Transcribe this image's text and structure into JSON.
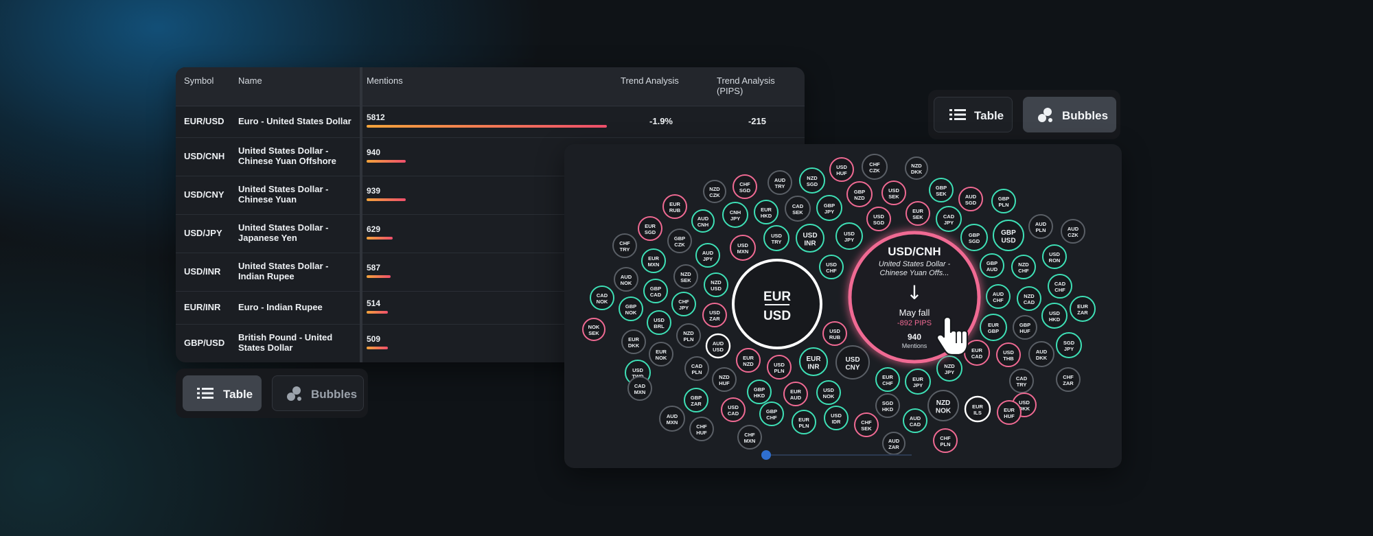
{
  "colors": {
    "positive": "#3ee0b6",
    "negative": "#f06a93",
    "neutral": "#5a5f66",
    "highlight": "#ffffff",
    "accent_text": "#f06a93",
    "bar_start": "#f3a43b",
    "bar_end": "#ef4f6c"
  },
  "table": {
    "headers": {
      "symbol": "Symbol",
      "name": "Name",
      "mentions": "Mentions",
      "trend": "Trend Analysis",
      "pips_line1": "Trend Analysis",
      "pips_line2": "(PIPS)"
    },
    "rows": [
      {
        "symbol": "EUR/USD",
        "name": "Euro - United States Dollar",
        "mentions": "5812",
        "trend": "-1.9%",
        "pips": "-215"
      },
      {
        "symbol": "USD/CNH",
        "name": "United States Dollar - Chinese Yuan Offshore",
        "mentions": "940",
        "trend": "",
        "pips": ""
      },
      {
        "symbol": "USD/CNY",
        "name": "United States Dollar - Chinese Yuan",
        "mentions": "939",
        "trend": "",
        "pips": ""
      },
      {
        "symbol": "USD/JPY",
        "name": "United States Dollar - Japanese Yen",
        "mentions": "629",
        "trend": "",
        "pips": ""
      },
      {
        "symbol": "USD/INR",
        "name": "United States Dollar - Indian Rupee",
        "mentions": "587",
        "trend": "",
        "pips": ""
      },
      {
        "symbol": "EUR/INR",
        "name": "Euro - Indian Rupee",
        "mentions": "514",
        "trend": "",
        "pips": ""
      },
      {
        "symbol": "GBP/USD",
        "name": "British Pound - United States Dollar",
        "mentions": "509",
        "trend": "",
        "pips": ""
      }
    ]
  },
  "toggle_left": {
    "table_label": "Table",
    "bubbles_label": "Bubbles",
    "selected": "Table"
  },
  "toggle_right": {
    "table_label": "Table",
    "bubbles_label": "Bubbles",
    "selected": "Bubbles"
  },
  "bubble_chart": {
    "big_left": {
      "base": "EUR",
      "quote": "USD",
      "state": "highlight"
    },
    "focus": {
      "pair": "USD/CNH",
      "name": "United States Dollar - Chinese Yuan Offs...",
      "arrow": "↓",
      "status": "May fall",
      "pips": "-892 PIPS",
      "mentions": "940",
      "mentions_label": "Mentions",
      "state": "negative"
    },
    "timeline_value": 0,
    "bubbles": [
      {
        "b": "USD",
        "q": "HUF",
        "s": "neg"
      },
      {
        "b": "CHF",
        "q": "CZK",
        "s": "neu"
      },
      {
        "b": "NZD",
        "q": "DKK",
        "s": "neu"
      },
      {
        "b": "AUD",
        "q": "TRY",
        "s": "neu"
      },
      {
        "b": "NZD",
        "q": "SGD",
        "s": "pos"
      },
      {
        "b": "CHF",
        "q": "SGD",
        "s": "neg"
      },
      {
        "b": "GBP",
        "q": "NZD",
        "s": "neg"
      },
      {
        "b": "USD",
        "q": "SEK",
        "s": "neg"
      },
      {
        "b": "GBP",
        "q": "SEK",
        "s": "pos"
      },
      {
        "b": "NZD",
        "q": "CZK",
        "s": "neu"
      },
      {
        "b": "AUD",
        "q": "SGD",
        "s": "neg"
      },
      {
        "b": "GBP",
        "q": "PLN",
        "s": "pos"
      },
      {
        "b": "EUR",
        "q": "RUB",
        "s": "neg"
      },
      {
        "b": "CNH",
        "q": "JPY",
        "s": "pos"
      },
      {
        "b": "EUR",
        "q": "HKD",
        "s": "pos"
      },
      {
        "b": "CAD",
        "q": "SEK",
        "s": "neu"
      },
      {
        "b": "GBP",
        "q": "JPY",
        "s": "pos"
      },
      {
        "b": "EUR",
        "q": "SEK",
        "s": "neg"
      },
      {
        "b": "CAD",
        "q": "JPY",
        "s": "pos"
      },
      {
        "b": "AUD",
        "q": "CNH",
        "s": "pos"
      },
      {
        "b": "USD",
        "q": "SGD",
        "s": "neg"
      },
      {
        "b": "EUR",
        "q": "SGD",
        "s": "neg"
      },
      {
        "b": "GBP",
        "q": "CZK",
        "s": "neu"
      },
      {
        "b": "USD",
        "q": "TRY",
        "s": "pos"
      },
      {
        "b": "USD",
        "q": "INR",
        "s": "pos"
      },
      {
        "b": "USD",
        "q": "JPY",
        "s": "pos"
      },
      {
        "b": "GBP",
        "q": "SGD",
        "s": "pos"
      },
      {
        "b": "GBP",
        "q": "USD",
        "s": "pos"
      },
      {
        "b": "AUD",
        "q": "PLN",
        "s": "neu"
      },
      {
        "b": "AUD",
        "q": "CZK",
        "s": "neu"
      },
      {
        "b": "CHF",
        "q": "TRY",
        "s": "neu"
      },
      {
        "b": "USD",
        "q": "MXN",
        "s": "neg"
      },
      {
        "b": "AUD",
        "q": "JPY",
        "s": "pos"
      },
      {
        "b": "EUR",
        "q": "MXN",
        "s": "pos"
      },
      {
        "b": "USD",
        "q": "CHF",
        "s": "pos"
      },
      {
        "b": "GBP",
        "q": "AUD",
        "s": "pos"
      },
      {
        "b": "NZD",
        "q": "CHF",
        "s": "pos"
      },
      {
        "b": "USD",
        "q": "RON",
        "s": "pos"
      },
      {
        "b": "AUD",
        "q": "NOK",
        "s": "neu"
      },
      {
        "b": "NZD",
        "q": "SEK",
        "s": "neu"
      },
      {
        "b": "NZD",
        "q": "USD",
        "s": "pos"
      },
      {
        "b": "GBP",
        "q": "CAD",
        "s": "pos"
      },
      {
        "b": "CAD",
        "q": "CHF",
        "s": "pos"
      },
      {
        "b": "AUD",
        "q": "CHF",
        "s": "pos"
      },
      {
        "b": "NZD",
        "q": "CAD",
        "s": "pos"
      },
      {
        "b": "CAD",
        "q": "NOK",
        "s": "pos"
      },
      {
        "b": "GBP",
        "q": "NOK",
        "s": "pos"
      },
      {
        "b": "CHF",
        "q": "JPY",
        "s": "pos"
      },
      {
        "b": "USD",
        "q": "ZAR",
        "s": "neg"
      },
      {
        "b": "EUR",
        "q": "ZAR",
        "s": "pos"
      },
      {
        "b": "USD",
        "q": "HKD",
        "s": "pos"
      },
      {
        "b": "NOK",
        "q": "SEK",
        "s": "neg"
      },
      {
        "b": "USD",
        "q": "BRL",
        "s": "pos"
      },
      {
        "b": "USD",
        "q": "RUB",
        "s": "neg"
      },
      {
        "b": "EUR",
        "q": "GBP",
        "s": "pos"
      },
      {
        "b": "GBP",
        "q": "HUF",
        "s": "neu"
      },
      {
        "b": "SGD",
        "q": "JPY",
        "s": "pos"
      },
      {
        "b": "EUR",
        "q": "DKK",
        "s": "neu"
      },
      {
        "b": "NZD",
        "q": "PLN",
        "s": "neu"
      },
      {
        "b": "EUR",
        "q": "NOK",
        "s": "neu"
      },
      {
        "b": "AUD",
        "q": "USD",
        "s": "highlight"
      },
      {
        "b": "EUR",
        "q": "NZD",
        "s": "neg"
      },
      {
        "b": "USD",
        "q": "PLN",
        "s": "neg"
      },
      {
        "b": "EUR",
        "q": "INR",
        "s": "pos"
      },
      {
        "b": "USD",
        "q": "CNY",
        "s": "neu"
      },
      {
        "b": "EUR",
        "q": "CAD",
        "s": "neg"
      },
      {
        "b": "USD",
        "q": "THB",
        "s": "neg"
      },
      {
        "b": "AUD",
        "q": "DKK",
        "s": "neu"
      },
      {
        "b": "CAD",
        "q": "PLN",
        "s": "neu"
      },
      {
        "b": "NZD",
        "q": "HUF",
        "s": "neu"
      },
      {
        "b": "USD",
        "q": "TWD",
        "s": "pos"
      },
      {
        "b": "NZD",
        "q": "JPY",
        "s": "pos"
      },
      {
        "b": "EUR",
        "q": "CHF",
        "s": "pos"
      },
      {
        "b": "EUR",
        "q": "JPY",
        "s": "pos"
      },
      {
        "b": "CHF",
        "q": "ZAR",
        "s": "neu"
      },
      {
        "b": "CAD",
        "q": "TRY",
        "s": "neu"
      },
      {
        "b": "USD",
        "q": "DKK",
        "s": "neg"
      },
      {
        "b": "CAD",
        "q": "MXN",
        "s": "neu"
      },
      {
        "b": "GBP",
        "q": "HKD",
        "s": "pos"
      },
      {
        "b": "EUR",
        "q": "AUD",
        "s": "neg"
      },
      {
        "b": "USD",
        "q": "NOK",
        "s": "pos"
      },
      {
        "b": "GBP",
        "q": "ZAR",
        "s": "pos"
      },
      {
        "b": "NZD",
        "q": "NOK",
        "s": "neu"
      },
      {
        "b": "USD",
        "q": "CAD",
        "s": "neg"
      },
      {
        "b": "AUD",
        "q": "MXN",
        "s": "neu"
      },
      {
        "b": "SGD",
        "q": "HKD",
        "s": "neu"
      },
      {
        "b": "EUR",
        "q": "ILS",
        "s": "highlight"
      },
      {
        "b": "EUR",
        "q": "HUF",
        "s": "neg"
      },
      {
        "b": "GBP",
        "q": "DKK",
        "s": "pos"
      },
      {
        "b": "GBP",
        "q": "CHF",
        "s": "pos"
      },
      {
        "b": "EUR",
        "q": "PLN",
        "s": "pos"
      },
      {
        "b": "USD",
        "q": "IDR",
        "s": "pos"
      },
      {
        "b": "CHF",
        "q": "SEK",
        "s": "neg"
      },
      {
        "b": "AUD",
        "q": "CAD",
        "s": "pos"
      },
      {
        "b": "CHF",
        "q": "HUF",
        "s": "neu"
      },
      {
        "b": "CHF",
        "q": "MXN",
        "s": "neu"
      },
      {
        "b": "CHF",
        "q": "PLN",
        "s": "neg"
      },
      {
        "b": "AUD",
        "q": "ZAR",
        "s": "neu"
      }
    ]
  }
}
